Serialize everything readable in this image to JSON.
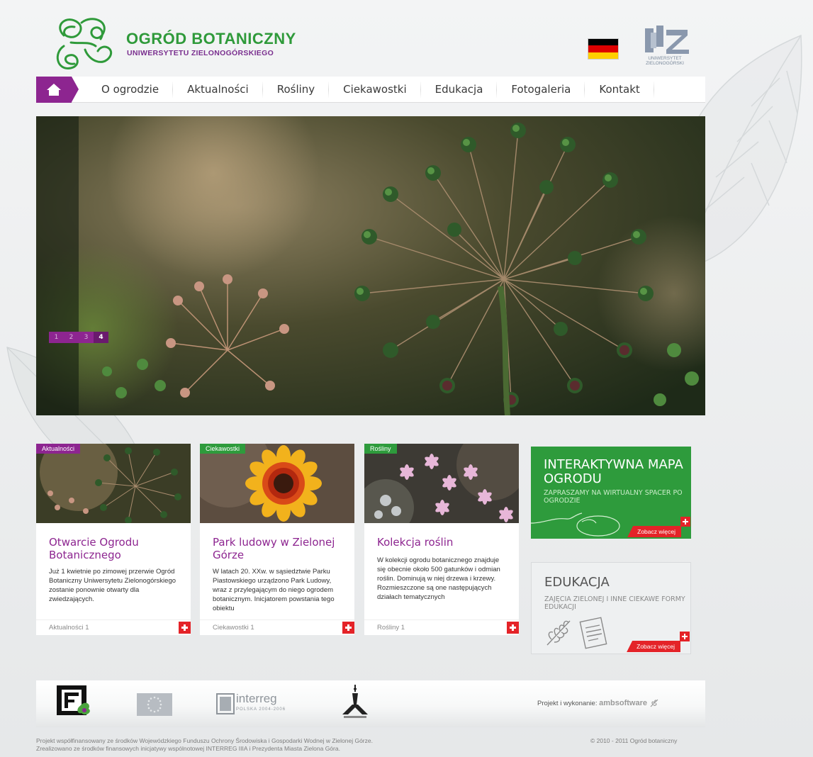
{
  "header": {
    "logo_title": "OGRÓD BOTANICZNY",
    "logo_subtitle": "UNIWERSYTETU ZIELONOGÓRSKIEGO",
    "uz_logo_text_1": "UNIWERSYTET",
    "uz_logo_text_2": "ZIELONOGÓRSKI"
  },
  "nav": {
    "items": [
      {
        "label": "O ogrodzie"
      },
      {
        "label": "Aktualności"
      },
      {
        "label": "Rośliny"
      },
      {
        "label": "Ciekawostki"
      },
      {
        "label": "Edukacja"
      },
      {
        "label": "Fotogaleria"
      },
      {
        "label": "Kontakt"
      }
    ]
  },
  "slider": {
    "pages": [
      "1",
      "2",
      "3",
      "4"
    ],
    "active_page": "4"
  },
  "cards": [
    {
      "tag": "Aktualności",
      "title": "Otwarcie Ogrodu Botanicznego",
      "text": "Już 1 kwietnie po zimowej przerwie Ogród Botaniczny Uniwersytetu Zielonogórskiego zostanie ponownie otwarty dla zwiedzających.",
      "footer": "Aktualności 1"
    },
    {
      "tag": "Ciekawostki",
      "title": "Park ludowy w Zielonej Górze",
      "text": "W latach 20. XXw. w sąsiedztwie Parku Piastowskiego urządzono Park Ludowy, wraz z przylegającym do niego ogrodem botanicznym. Inicjatorem powstania tego obiektu",
      "footer": "Ciekawostki 1"
    },
    {
      "tag": "Rośliny",
      "title": "Kolekcja roślin",
      "text": "W kolekcji ogrodu botanicznego znajduje się obecnie około 500 gatunków i odmian roślin. Dominują w niej drzewa i krzewy. Rozmieszczone są one następujących działach tematycznych",
      "footer": "Rośliny 1"
    }
  ],
  "promos": {
    "map": {
      "title": "INTERAKTYWNA MAPA OGRODU",
      "subtitle": "ZAPRASZAMY NA WIRTUALNY SPACER PO OGRODZIE",
      "more": "Zobacz więcej"
    },
    "edu": {
      "title": "EDUKACJA",
      "subtitle": "ZAJĘCIA ZIELONEJ I INNE CIEKAWE FORMY EDUKACJI",
      "more": "Zobacz więcej"
    }
  },
  "partners": {
    "interreg_name": "interreg",
    "interreg_sub": "POLSKA 2004-2006",
    "credits_label": "Projekt i wykonanie:",
    "credits_company": "ambsoftware"
  },
  "footer": {
    "line1": "Projekt współfinansowany ze środków Wojewódzkiego Funduszu Ochrony Środowiska i Gospodarki Wodnej w Zielonej Górze.",
    "line2": "Zrealizowano ze środków finansowych inicjatywy wspólnotowej INTERREG IIIA i Prezydenta Miasta Zielona Góra.",
    "copyright": "© 2010 - 2011 Ogród botaniczny"
  },
  "colors": {
    "brand_purple": "#8d2590",
    "brand_green": "#2e9b3c",
    "accent_red": "#e42328"
  }
}
